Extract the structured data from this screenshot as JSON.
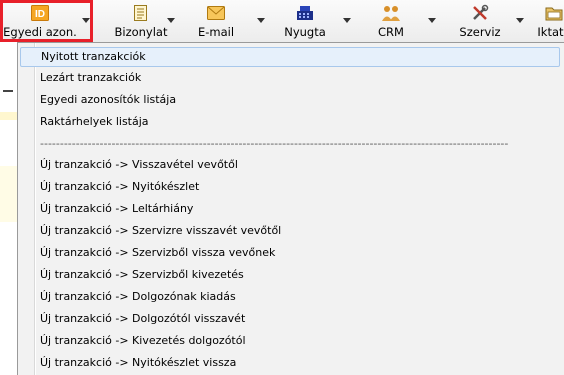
{
  "toolbar": {
    "buttons": [
      {
        "label": "Egyedi azon.",
        "icon": "id-icon"
      },
      {
        "label": "Bizonylat",
        "icon": "document-icon"
      },
      {
        "label": "E-mail",
        "icon": "envelope-icon"
      },
      {
        "label": "Nyugta",
        "icon": "cash-register-icon"
      },
      {
        "label": "CRM",
        "icon": "people-icon"
      },
      {
        "label": "Szerviz",
        "icon": "tools-icon"
      },
      {
        "label": "Iktatá",
        "icon": "folder-icon"
      }
    ]
  },
  "menu": {
    "items": [
      "Nyitott tranzakciók",
      "Lezárt tranzakciók",
      "Egyedi azonosítók listája",
      "Raktárhelyek listája"
    ],
    "separator": "----------------------------------------------------------------------------------------------------------------------",
    "transactions": [
      "Új tranzakció -> Visszavétel vevőtől",
      "Új tranzakció -> Nyitókészlet",
      "Új tranzakció -> Leltárhiány",
      "Új tranzakció -> Szervizre visszavét vevőtől",
      "Új tranzakció -> Szervizből vissza vevőnek",
      "Új tranzakció -> Szervizből kivezetés",
      "Új tranzakció -> Dolgozónak kiadás",
      "Új tranzakció -> Dolgozótól visszavét",
      "Új tranzakció -> Kivezetés dolgozótól",
      "Új tranzakció -> Nyitókészlet vissza"
    ]
  },
  "colors": {
    "highlight_border": "#e8202a",
    "hover_bg": "#e6f0fb",
    "id_icon": "#f0a020"
  }
}
